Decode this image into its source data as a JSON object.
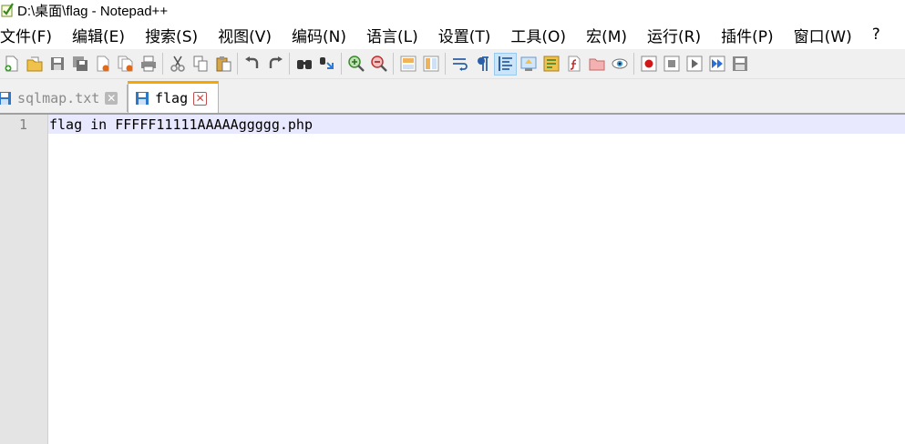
{
  "window": {
    "title": "D:\\桌面\\flag - Notepad++"
  },
  "menu": {
    "items": [
      {
        "label": "文件(F)"
      },
      {
        "label": "编辑(E)"
      },
      {
        "label": "搜索(S)"
      },
      {
        "label": "视图(V)"
      },
      {
        "label": "编码(N)"
      },
      {
        "label": "语言(L)"
      },
      {
        "label": "设置(T)"
      },
      {
        "label": "工具(O)"
      },
      {
        "label": "宏(M)"
      },
      {
        "label": "运行(R)"
      },
      {
        "label": "插件(P)"
      },
      {
        "label": "窗口(W)"
      },
      {
        "label": "?"
      }
    ]
  },
  "toolbar": {
    "icons": [
      "new-file-icon",
      "open-file-icon",
      "save-icon",
      "save-all-icon",
      "close-icon",
      "close-all-icon",
      "print-icon",
      "cut-icon",
      "copy-icon",
      "paste-icon",
      "undo-icon",
      "redo-icon",
      "find-icon",
      "replace-icon",
      "zoom-in-icon",
      "zoom-out-icon",
      "sync-vertical-icon",
      "sync-horizontal-icon",
      "word-wrap-icon",
      "show-all-chars-icon",
      "indent-guide-icon",
      "folder-as-workspace-icon",
      "doc-map-icon",
      "function-list-icon",
      "folder-icon",
      "monitoring-icon",
      "record-macro-icon",
      "stop-record-icon",
      "play-macro-icon",
      "run-macro-multiple-icon",
      "save-macro-icon"
    ]
  },
  "tabs": [
    {
      "label": "sqlmap.txt",
      "active": false
    },
    {
      "label": "flag",
      "active": true
    }
  ],
  "editor": {
    "lines": [
      {
        "number": "1",
        "text": "flag in FFFFF11111AAAAAggggg.php"
      }
    ]
  },
  "colors": {
    "active_tab_accent": "#f7a600",
    "current_line_bg": "#e8e8ff",
    "gutter_bg": "#e4e4e4"
  }
}
